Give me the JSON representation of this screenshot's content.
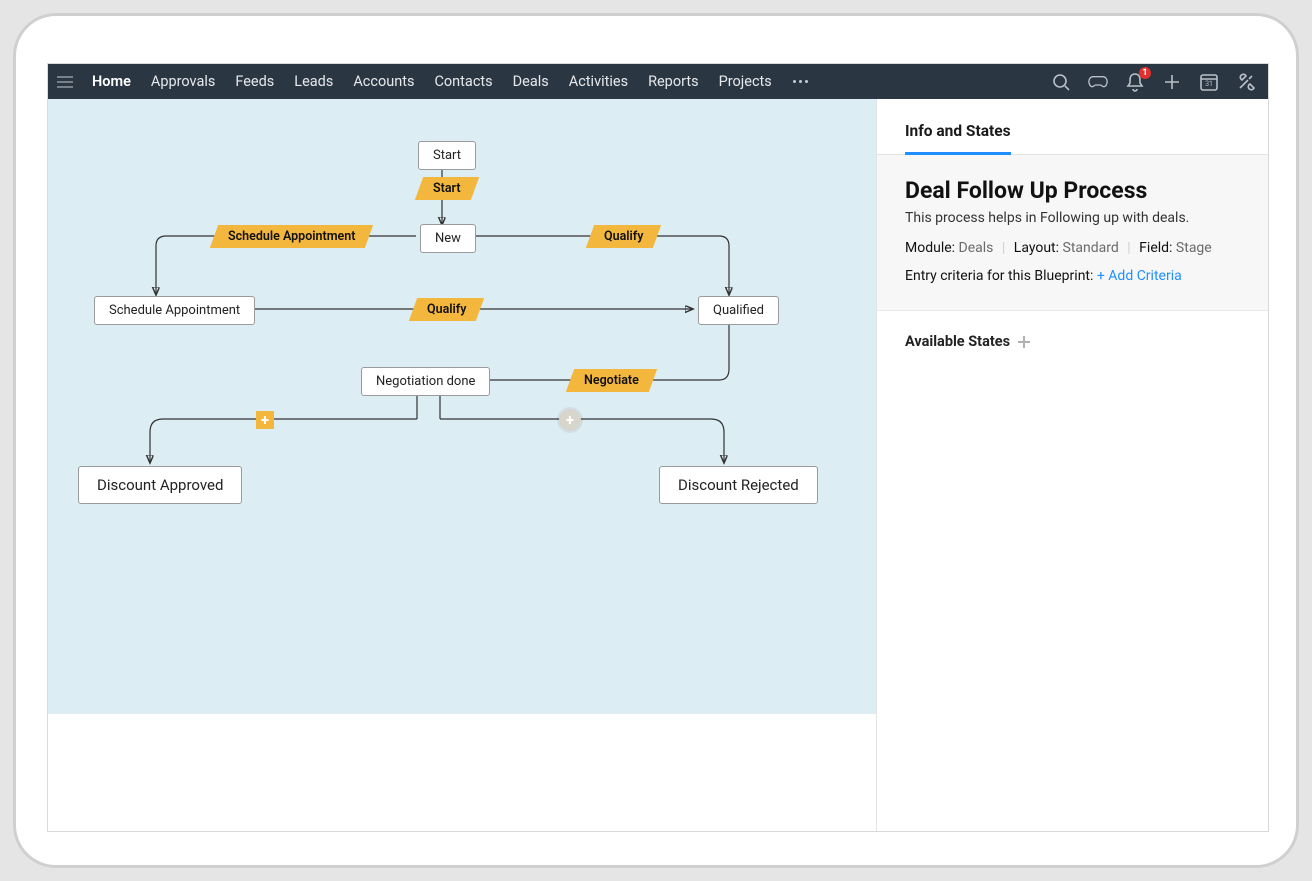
{
  "nav": {
    "items": [
      "Home",
      "Approvals",
      "Feeds",
      "Leads",
      "Accounts",
      "Contacts",
      "Deals",
      "Activities",
      "Reports",
      "Projects"
    ],
    "notifications_badge": "1",
    "calendar_day": "31"
  },
  "panel": {
    "tab": "Info and States",
    "title": "Deal Follow Up Process",
    "description": "This process helps in Following up with deals.",
    "meta": {
      "module_label": "Module:",
      "module_value": "Deals",
      "layout_label": "Layout:",
      "layout_value": "Standard",
      "field_label": "Field:",
      "field_value": "Stage"
    },
    "criteria_label": "Entry criteria for this Blueprint: ",
    "criteria_link": "+ Add Criteria",
    "available_states_label": "Available States"
  },
  "flow": {
    "nodes": {
      "start": "Start",
      "new": "New",
      "schedule_appt": "Schedule Appointment",
      "qualified": "Qualified",
      "negotiation_done": "Negotiation done",
      "discount_approved": "Discount Approved",
      "discount_rejected": "Discount Rejected"
    },
    "transitions": {
      "t_start": "Start",
      "t_schedule": "Schedule Appointment",
      "t_qualify_top": "Qualify",
      "t_qualify_mid": "Qualify",
      "t_negotiate": "Negotiate"
    }
  }
}
